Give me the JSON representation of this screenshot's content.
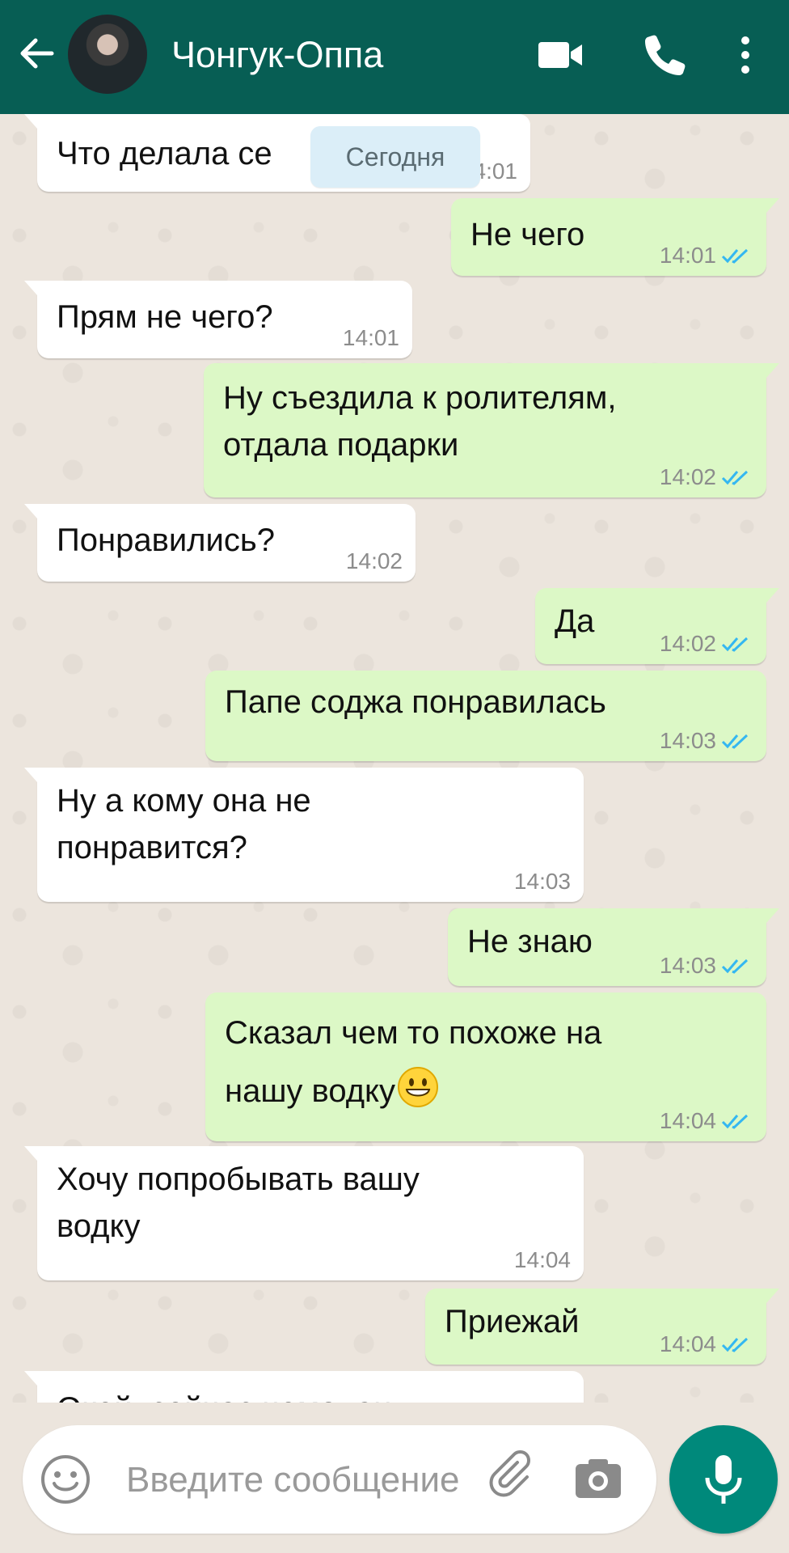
{
  "header": {
    "title": "Чонгук-Оппа",
    "background": "#075e54"
  },
  "date_chip": "Сегодня",
  "messages": [
    {
      "dir": "in",
      "text": "Что делала се",
      "time": "14:01"
    },
    {
      "dir": "out",
      "text": "Не чего",
      "time": "14:01",
      "read": true
    },
    {
      "dir": "in",
      "text": "Прям не чего?",
      "time": "14:01"
    },
    {
      "dir": "out",
      "lines": [
        "Ну съездила к ролителям,",
        "отдала подарки"
      ],
      "time": "14:02",
      "read": true
    },
    {
      "dir": "in",
      "text": "Понравились?",
      "time": "14:02"
    },
    {
      "dir": "out",
      "text": "Да",
      "time": "14:02",
      "read": true
    },
    {
      "dir": "out",
      "text": "Папе соджа понравилась",
      "time": "14:03",
      "read": true
    },
    {
      "dir": "in",
      "lines": [
        "Ну а кому она не",
        "понравится?"
      ],
      "time": "14:03"
    },
    {
      "dir": "out",
      "text": "Не знаю",
      "time": "14:03",
      "read": true
    },
    {
      "dir": "out",
      "lines": [
        "Сказал чем то похоже на",
        "нашу водку"
      ],
      "emoji": "smiley",
      "time": "14:04",
      "read": true
    },
    {
      "dir": "in",
      "lines": [
        "Хочу попробывать вашу",
        "водку"
      ],
      "time": "14:04"
    },
    {
      "dir": "out",
      "text": "Приежай",
      "time": "14:04",
      "read": true
    },
    {
      "dir": "in",
      "text": "Окей, сейчас чемодан",
      "time": ""
    }
  ],
  "input": {
    "placeholder": "Введите сообщение"
  },
  "colors": {
    "incoming": "#ffffff",
    "outgoing": "#dcf8c6",
    "read_check": "#34b7f1",
    "mic_button": "#00897b"
  },
  "icons": [
    "back-arrow-icon",
    "video-call-icon",
    "phone-icon",
    "more-vert-icon",
    "emoji-icon",
    "attach-icon",
    "camera-icon",
    "mic-icon"
  ]
}
